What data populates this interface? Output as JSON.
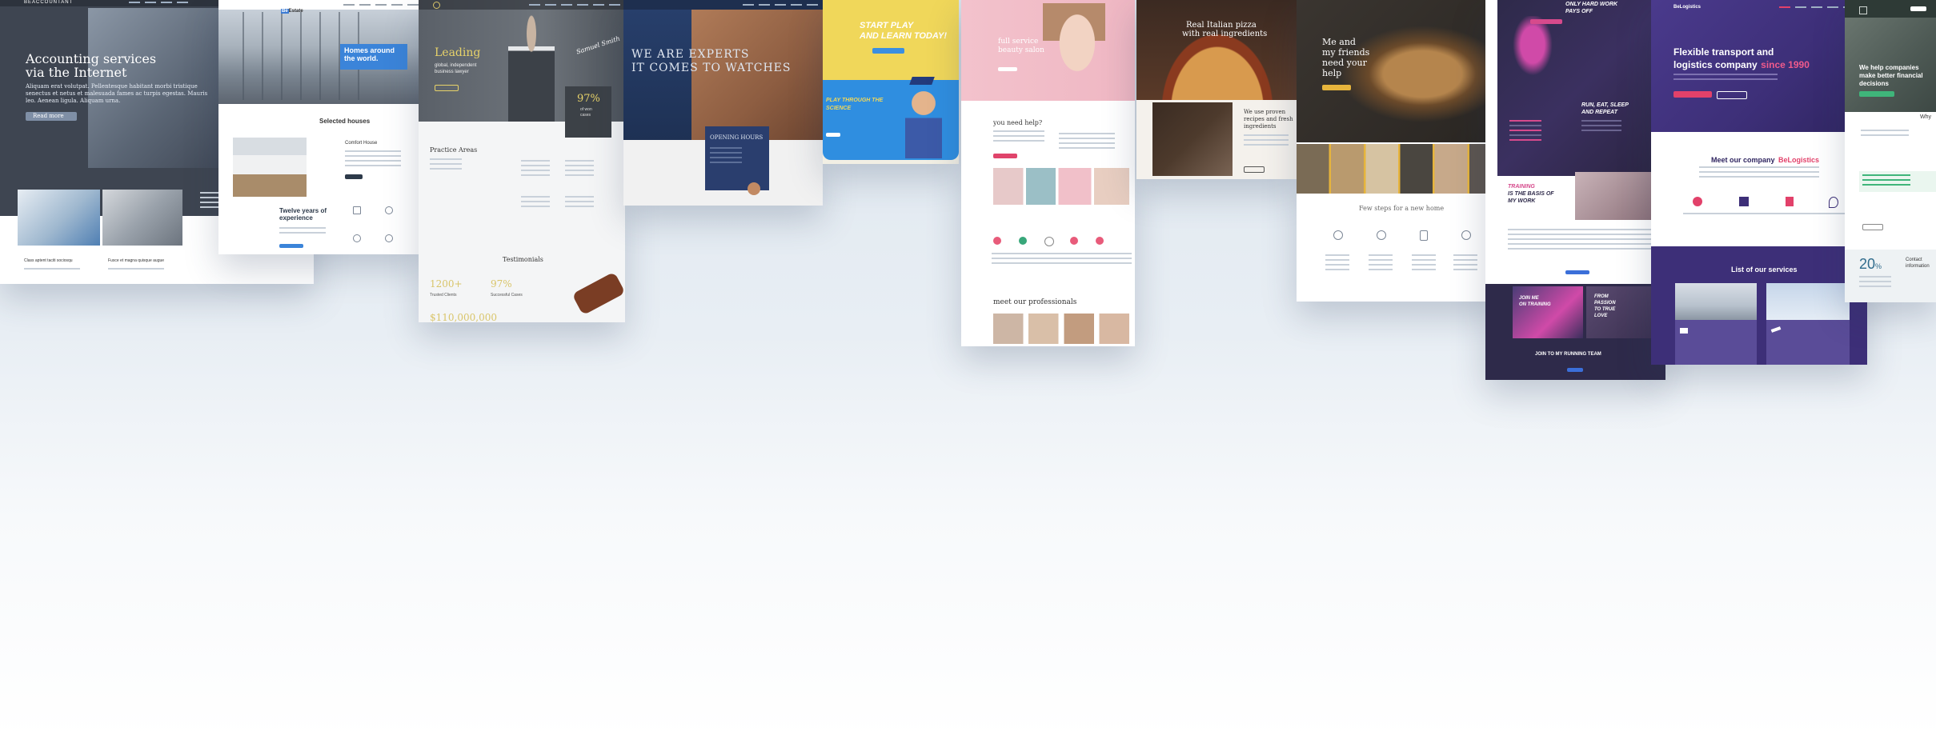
{
  "accounting": {
    "logo": "BEACCOUNTANT",
    "headline_1": "Accounting services",
    "headline_2": "via the Internet",
    "body": "Aliquam erat volutpat. Pellentesque habitant morbi tristique senectus et netus et malesuada fames ac turpis egestas. Mauris leo. Aenean ligula. Aliquam urna.",
    "button": "Read more",
    "post_1": "Class aptent taciti sociosqu",
    "post_2": "Fusce et magna quisque augue"
  },
  "realestate": {
    "logo": "Be",
    "logo_rest": "Estate",
    "hero_1": "Homes around",
    "hero_2": "the world.",
    "section": "Selected houses",
    "listing": "Comfort House",
    "years_1": "Twelve years of",
    "years_2": "experience"
  },
  "lawyer": {
    "hero_1": "Leading",
    "hero_2": "global, independent",
    "hero_3": "business lawyer",
    "signature": "Samuel Smith",
    "percent": "97%",
    "percent_label_1": "of won",
    "percent_label_2": "cases",
    "practice": "Practice Areas",
    "testimonials": "Testimonials",
    "stat_1": "1200+",
    "stat_1_label": "Trusted Clients",
    "stat_2": "97%",
    "stat_2_label": "Successful Cases",
    "stat_3": "$110,000,000"
  },
  "watches": {
    "hero_1": "WE ARE EXPERTS",
    "hero_2": "IT COMES TO WATCHES",
    "box": "OPENING HOURS"
  },
  "kids": {
    "head_1": "START PLAY",
    "head_2": "AND LEARN TODAY!",
    "science_1": "PLAY THROUGH THE",
    "science_2": "SCIENCE"
  },
  "beauty": {
    "hero_1": "full service",
    "hero_2": "beauty salon",
    "help": "you need help?",
    "pros": "meet our professionals"
  },
  "pizza": {
    "hero_1": "Real Italian pizza",
    "hero_2": "with real ingredients",
    "recipes_1": "We use proven",
    "recipes_2": "recipes and fresh",
    "recipes_3": "ingredients"
  },
  "pets": {
    "hero_1": "Me and",
    "hero_2": "my friends",
    "hero_3": "need your",
    "hero_4": "help",
    "steps": "Few steps for a new home"
  },
  "fitness": {
    "hero_1": "ONLY HARD WORK",
    "hero_2": "PAYS OFF",
    "run_1": "RUN, EAT, SLEEP",
    "run_2": "AND REPEAT",
    "training_1": "TRAINING",
    "training_2": "IS THE BASIS OF",
    "training_3": "MY WORK",
    "join_1": "JOIN ME",
    "join_2": "ON TRAINING",
    "passion_1": "FROM",
    "passion_2": "PASSION",
    "passion_3": "TO TRUE",
    "passion_4": "LOVE",
    "team": "JOIN TO MY RUNNING TEAM"
  },
  "logistics": {
    "logo": "BeLogistics",
    "hero_1": "Flexible transport and",
    "hero_2": "logistics company",
    "hero_year": "since 1990",
    "meet": "Meet our company",
    "meet_brand": "BeLogistics",
    "services": "List of our services"
  },
  "finance": {
    "hero_1": "We help companies",
    "hero_2": "make better financial",
    "hero_3": "decisions",
    "why": "Why",
    "stat": "20",
    "stat_unit": "%",
    "contact": "Contact",
    "contact_2": "information"
  }
}
